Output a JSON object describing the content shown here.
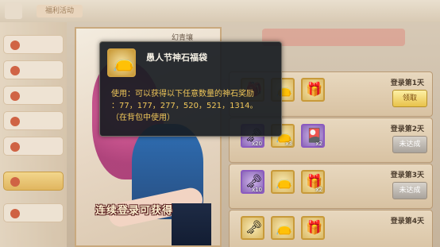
{
  "top": {
    "tab_label": "福利活动"
  },
  "art": {
    "char_name": "幻青壤",
    "slogan": "连续登录可获得"
  },
  "tooltip": {
    "icon": "lucky-bag-icon",
    "title": "愚人节神石福袋",
    "desc_line1": "使用：可以获得以下任意数量的神石奖励",
    "desc_line2": "：77，177，277，520，521，1314。",
    "desc_line3": "（在背包中使用）"
  },
  "rows": [
    {
      "day": "登录第1天",
      "button": "领取",
      "state": "claim",
      "items": [
        {
          "icon": "lucky-bag-icon",
          "qty": ""
        },
        {
          "icon": "lucky-bag-icon",
          "qty": ""
        },
        {
          "icon": "gift-box-icon",
          "qty": ""
        }
      ]
    },
    {
      "day": "登录第2天",
      "button": "未达成",
      "state": "locked",
      "items": [
        {
          "icon": "key-icon",
          "qty": "x20"
        },
        {
          "icon": "lucky-bag-icon",
          "qty": "x3"
        },
        {
          "icon": "treasure-icon",
          "qty": "x2"
        }
      ]
    },
    {
      "day": "登录第3天",
      "button": "未达成",
      "state": "locked",
      "items": [
        {
          "icon": "key-icon",
          "qty": "x10"
        },
        {
          "icon": "lucky-bag-icon",
          "qty": ""
        },
        {
          "icon": "gift-box-icon",
          "qty": "x2"
        }
      ]
    },
    {
      "day": "登录第4天",
      "button": "",
      "state": "locked",
      "items": [
        {
          "icon": "key-icon",
          "qty": ""
        },
        {
          "icon": "lucky-bag-icon",
          "qty": ""
        },
        {
          "icon": "gift-box-icon",
          "qty": ""
        }
      ]
    }
  ]
}
